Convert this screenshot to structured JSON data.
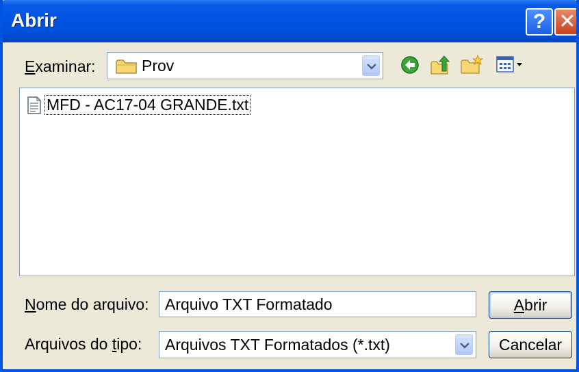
{
  "window": {
    "title": "Abrir"
  },
  "titlebar": {
    "help_glyph": "?",
    "close_glyph": "✕"
  },
  "lookin": {
    "label": "Examinar:",
    "value": "Prov"
  },
  "toolbar": {
    "icons": [
      "back-icon",
      "up-folder-icon",
      "new-folder-icon",
      "views-menu-icon"
    ]
  },
  "files": [
    {
      "name": "MFD - AC17-04 GRANDE.txt",
      "icon": "text-file-icon"
    }
  ],
  "filename": {
    "label": "Nome do arquivo:",
    "value": "Arquivo TXT Formatado"
  },
  "filetype": {
    "label": "Arquivos do tipo:",
    "value": "Arquivos TXT Formatados (*.txt)"
  },
  "buttons": {
    "open": "Abrir",
    "cancel": "Cancelar"
  },
  "colors": {
    "titlebar": "#0054e3",
    "dialog_bg": "#ece9d8",
    "field_border": "#7f9db9"
  }
}
